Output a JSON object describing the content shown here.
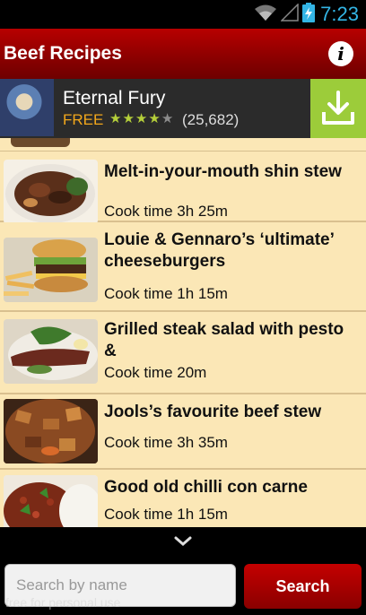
{
  "status_bar": {
    "time": "7:23"
  },
  "header": {
    "title": "Beef Recipes",
    "info_glyph": "i"
  },
  "ad": {
    "app_name": "Eternal Fury",
    "price": "FREE",
    "rating_stars": 4,
    "rating_max": 5,
    "reviews": "(25,682)",
    "accent_color": "#9ccc3a"
  },
  "recipes": [
    {
      "title": "Melt-in-your-mouth shin stew",
      "time": "Cook time 3h 25m"
    },
    {
      "title": "Louie & Gennaro’s ‘ultimate’ cheeseburgers",
      "time": "Cook time 1h 15m"
    },
    {
      "title": "Grilled steak salad with pesto &",
      "time": "Cook time 20m"
    },
    {
      "title": "Jools’s favourite beef stew",
      "time": "Cook time 3h 35m"
    },
    {
      "title": "Good old chilli con carne",
      "time": "Cook time 1h 15m"
    }
  ],
  "search": {
    "placeholder": "Search by name",
    "button_label": "Search"
  },
  "watermark": "free for personal use",
  "colors": {
    "header_red": "#b70000",
    "list_bg": "#fbe7b6",
    "status_blue": "#33b5e5"
  }
}
